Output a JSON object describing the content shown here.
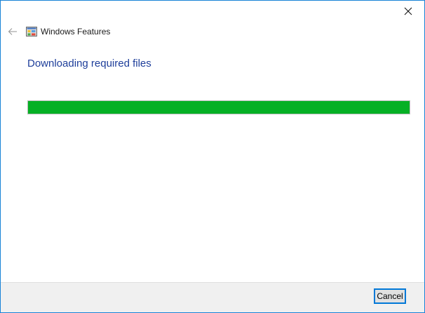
{
  "window": {
    "title": "Windows Features",
    "close_icon": "close-icon",
    "back_icon": "back-arrow-icon",
    "app_icon": "windows-features-icon"
  },
  "content": {
    "heading": "Downloading required files",
    "progress": {
      "percent": 100,
      "fill_color": "#06b025"
    }
  },
  "footer": {
    "cancel_label": "Cancel"
  },
  "colors": {
    "heading": "#1e3e9a",
    "window_border": "#1883d7",
    "footer_bg": "#f0f0f0"
  }
}
